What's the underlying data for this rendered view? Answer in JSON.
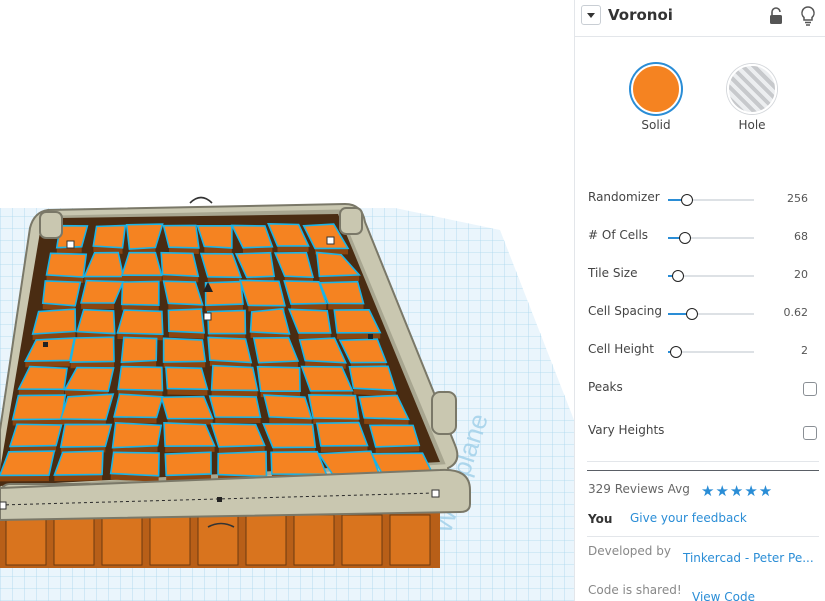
{
  "viewport": {
    "workplane_label": "Workplane",
    "colors": {
      "shape": "#f58321",
      "outline": "#19b4e8",
      "frame": "#9e9e8c",
      "grid": "#a9d6ee"
    }
  },
  "panel": {
    "title": "Voronoi",
    "icons": {
      "dropdown": "chevron-down-icon",
      "lock": "lock-icon",
      "bulb": "lightbulb-icon"
    },
    "solid_label": "Solid",
    "hole_label": "Hole",
    "params": [
      {
        "label": "Randomizer",
        "value": "256",
        "fraction": 0.22
      },
      {
        "label": "# Of Cells",
        "value": "68",
        "fraction": 0.2
      },
      {
        "label": "Tile Size",
        "value": "20",
        "fraction": 0.12
      },
      {
        "label": "Cell Spacing",
        "value": "0.62",
        "fraction": 0.28
      },
      {
        "label": "Cell Height",
        "value": "2",
        "fraction": 0.09
      }
    ],
    "toggles": [
      {
        "label": "Peaks",
        "checked": false
      },
      {
        "label": "Vary Heights",
        "checked": false
      }
    ],
    "reviews": {
      "text": "329 Reviews Avg",
      "stars": "★★★★★",
      "rating": 5
    },
    "you_label": "You",
    "feedback_link": "Give your feedback",
    "developed_by_label": "Developed by",
    "developer": "Tinkercad - Peter Pe...",
    "code_shared": "Code is shared!",
    "view_code": "View Code"
  }
}
